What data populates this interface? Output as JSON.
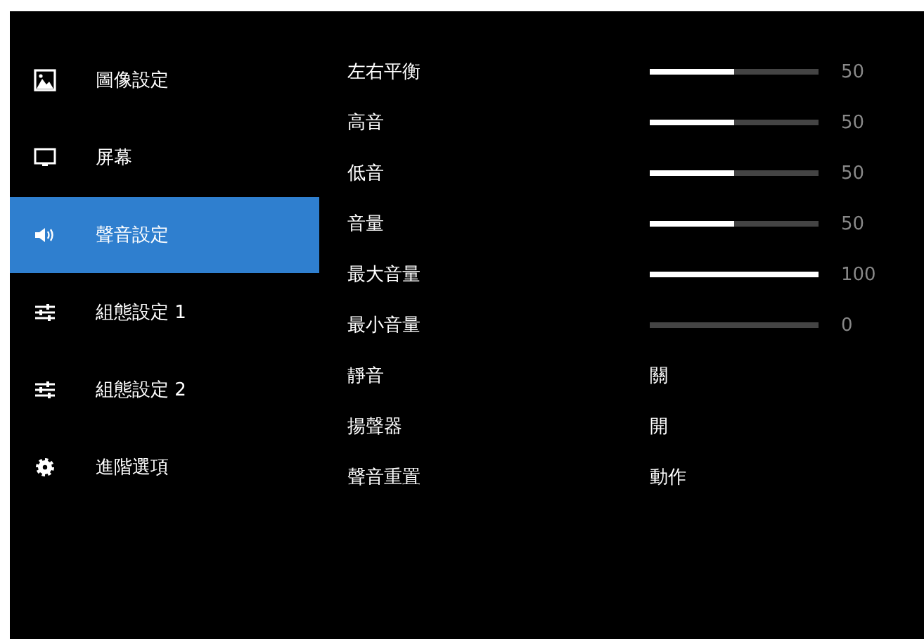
{
  "sidebar": {
    "items": [
      {
        "label": "圖像設定",
        "kind": "picture",
        "selected": false
      },
      {
        "label": "屏幕",
        "kind": "monitor",
        "selected": false
      },
      {
        "label": "聲音設定",
        "kind": "speaker",
        "selected": true
      },
      {
        "label": "組態設定 1",
        "kind": "sliders",
        "selected": false
      },
      {
        "label": "組態設定 2",
        "kind": "sliders",
        "selected": false
      },
      {
        "label": "進階選項",
        "kind": "gear",
        "selected": false
      }
    ]
  },
  "settings": [
    {
      "kind": "slider",
      "label": "左右平衡",
      "level": 0.5,
      "reading": "50"
    },
    {
      "kind": "slider",
      "label": "高音",
      "level": 0.5,
      "reading": "50"
    },
    {
      "kind": "slider",
      "label": "低音",
      "level": 0.5,
      "reading": "50"
    },
    {
      "kind": "slider",
      "label": "音量",
      "level": 0.5,
      "reading": "50"
    },
    {
      "kind": "slider",
      "label": "最大音量",
      "level": 1,
      "reading": "100"
    },
    {
      "kind": "slider",
      "label": "最小音量",
      "level": 0,
      "reading": "0"
    },
    {
      "kind": "option",
      "label": "靜音",
      "value": "關"
    },
    {
      "kind": "option",
      "label": "揚聲器",
      "value": "開"
    },
    {
      "kind": "option",
      "label": "聲音重置",
      "value": "動作"
    }
  ]
}
